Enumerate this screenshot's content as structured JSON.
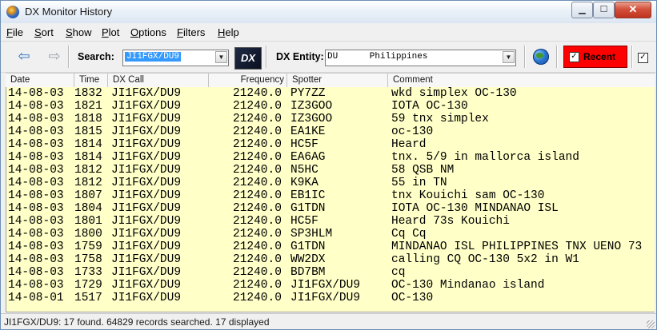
{
  "window": {
    "title": "DX Monitor History"
  },
  "menu": [
    "File",
    "Sort",
    "Show",
    "Plot",
    "Options",
    "Filters",
    "Help"
  ],
  "toolbar": {
    "search_label": "Search:",
    "search_value": "JI1FGX/DU9",
    "dx_logo_text": "DX",
    "entity_label": "DX Entity:",
    "entity_value": "DU      Philippines",
    "recent_label": "Recent",
    "recent_checked": "✓",
    "extra_checked": "✓"
  },
  "columns": [
    "Date",
    "Time",
    "DX Call",
    "Frequency",
    "Spotter",
    "Comment"
  ],
  "rows": [
    {
      "date": "14-08-03",
      "time": "1832",
      "call": "JI1FGX/DU9",
      "freq": "21240.0",
      "spotter": "PY7ZZ",
      "comment": "wkd simplex OC-130"
    },
    {
      "date": "14-08-03",
      "time": "1821",
      "call": "JI1FGX/DU9",
      "freq": "21240.0",
      "spotter": "IZ3GOO",
      "comment": "IOTA OC-130"
    },
    {
      "date": "14-08-03",
      "time": "1818",
      "call": "JI1FGX/DU9",
      "freq": "21240.0",
      "spotter": "IZ3GOO",
      "comment": "59 tnx simplex"
    },
    {
      "date": "14-08-03",
      "time": "1815",
      "call": "JI1FGX/DU9",
      "freq": "21240.0",
      "spotter": "EA1KE",
      "comment": "oc-130"
    },
    {
      "date": "14-08-03",
      "time": "1814",
      "call": "JI1FGX/DU9",
      "freq": "21240.0",
      "spotter": "HC5F",
      "comment": "Heard"
    },
    {
      "date": "14-08-03",
      "time": "1814",
      "call": "JI1FGX/DU9",
      "freq": "21240.0",
      "spotter": "EA6AG",
      "comment": "tnx. 5/9 in mallorca island"
    },
    {
      "date": "14-08-03",
      "time": "1812",
      "call": "JI1FGX/DU9",
      "freq": "21240.0",
      "spotter": "N5HC",
      "comment": "58 QSB NM"
    },
    {
      "date": "14-08-03",
      "time": "1812",
      "call": "JI1FGX/DU9",
      "freq": "21240.0",
      "spotter": "K9KA",
      "comment": "55 in TN"
    },
    {
      "date": "14-08-03",
      "time": "1807",
      "call": "JI1FGX/DU9",
      "freq": "21240.0",
      "spotter": "EB1IC",
      "comment": "tnx Kouichi sam OC-130"
    },
    {
      "date": "14-08-03",
      "time": "1804",
      "call": "JI1FGX/DU9",
      "freq": "21240.0",
      "spotter": "G1TDN",
      "comment": "IOTA OC-130 MINDANAO ISL"
    },
    {
      "date": "14-08-03",
      "time": "1801",
      "call": "JI1FGX/DU9",
      "freq": "21240.0",
      "spotter": "HC5F",
      "comment": "Heard 73s Kouichi"
    },
    {
      "date": "14-08-03",
      "time": "1800",
      "call": "JI1FGX/DU9",
      "freq": "21240.0",
      "spotter": "SP3HLM",
      "comment": "Cq Cq"
    },
    {
      "date": "14-08-03",
      "time": "1759",
      "call": "JI1FGX/DU9",
      "freq": "21240.0",
      "spotter": "G1TDN",
      "comment": "MINDANAO ISL PHILIPPINES TNX UENO 73"
    },
    {
      "date": "14-08-03",
      "time": "1758",
      "call": "JI1FGX/DU9",
      "freq": "21240.0",
      "spotter": "WW2DX",
      "comment": "calling CQ OC-130 5x2 in W1"
    },
    {
      "date": "14-08-03",
      "time": "1733",
      "call": "JI1FGX/DU9",
      "freq": "21240.0",
      "spotter": "BD7BM",
      "comment": "cq"
    },
    {
      "date": "14-08-03",
      "time": "1729",
      "call": "JI1FGX/DU9",
      "freq": "21240.0",
      "spotter": "JI1FGX/DU9",
      "comment": "OC-130 Mindanao island"
    },
    {
      "date": "14-08-01",
      "time": "1517",
      "call": "JI1FGX/DU9",
      "freq": "21240.0",
      "spotter": "JI1FGX/DU9",
      "comment": "OC-130"
    }
  ],
  "status": "JI1FGX/DU9: 17 found.  64829 records searched.  17 displayed"
}
